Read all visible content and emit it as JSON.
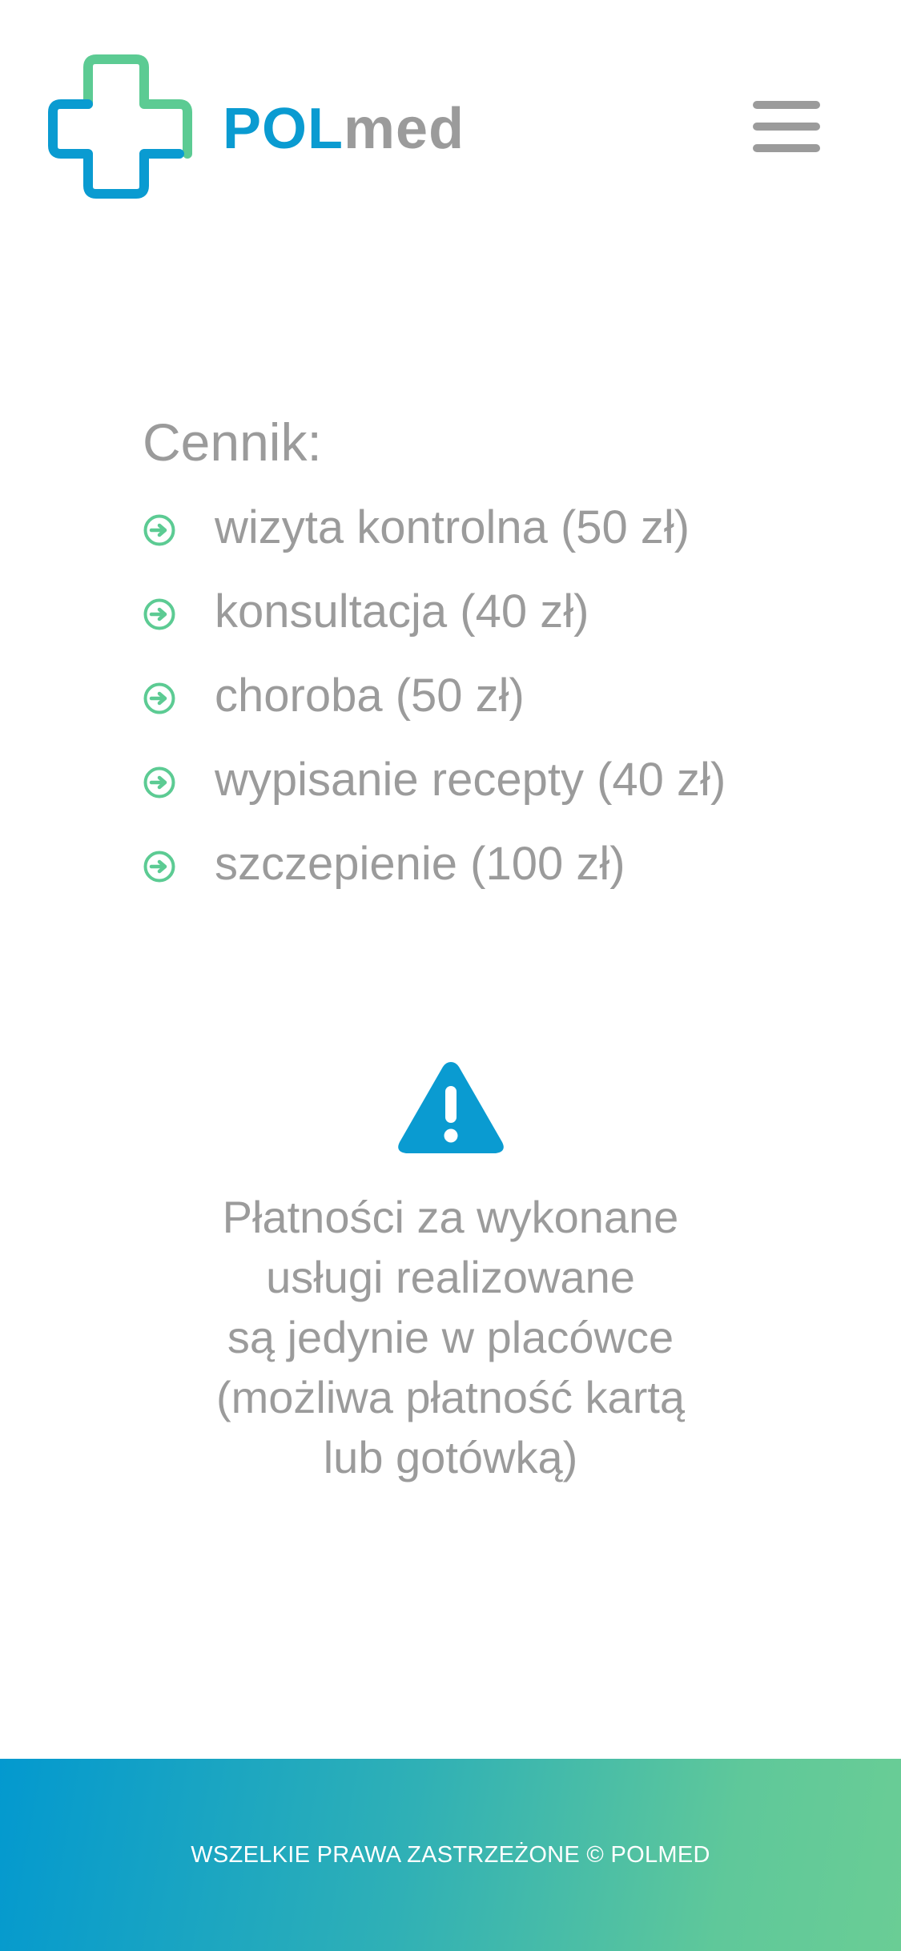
{
  "brand": {
    "part1": "POL",
    "part2": "med",
    "colors": {
      "blue": "#0a9bd1",
      "green": "#5ccb93",
      "gray": "#9b9b9b"
    }
  },
  "header": {
    "menu_icon": "hamburger-menu-icon"
  },
  "pricing": {
    "title": "Cennik:",
    "bullet_icon": "arrow-circle-right-icon",
    "items": [
      {
        "label": "wizyta kontrolna (50 zł)"
      },
      {
        "label": "konsultacja (40 zł)"
      },
      {
        "label": "choroba (50 zł)"
      },
      {
        "label": "wypisanie recepty (40 zł)"
      },
      {
        "label": "szczepienie (100 zł)"
      }
    ]
  },
  "notice": {
    "icon": "warning-triangle-icon",
    "lines": [
      "Płatności za wykonane",
      "usługi realizowane",
      "są jedynie w placówce",
      "(możliwa płatność kartą",
      "lub gotówką)"
    ]
  },
  "footer": {
    "text": "WSZELKIE PRAWA ZASTRZEŻONE © POLMED",
    "gradient_start": "#0399cf",
    "gradient_end": "#6acd95"
  }
}
